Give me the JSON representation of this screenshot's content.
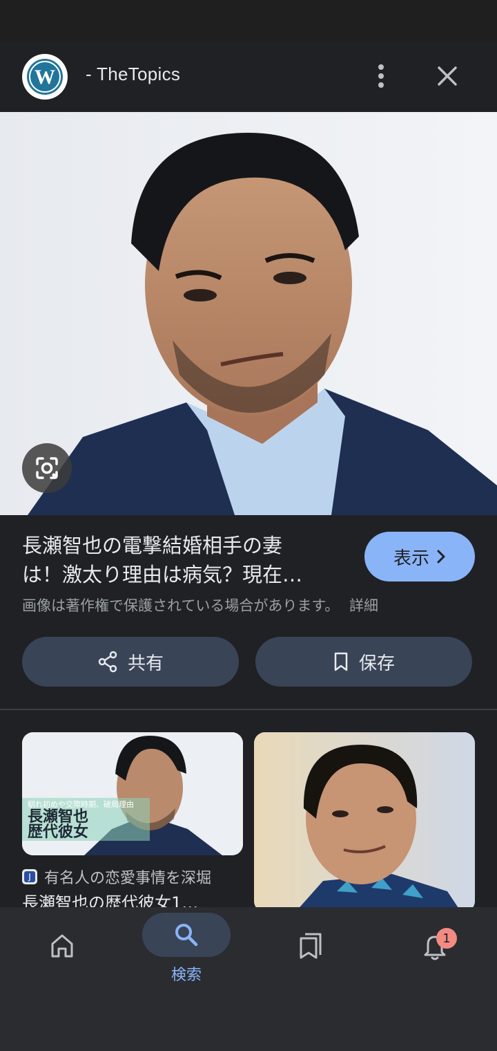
{
  "header": {
    "site_name": "- TheTopics",
    "logo_icon": "wordpress-icon",
    "menu_icon": "more-vert-icon",
    "close_icon": "close-icon"
  },
  "hero": {
    "lens_icon": "google-lens-icon"
  },
  "result": {
    "title_line1": "長瀬智也の電撃結婚相手の妻",
    "title_line2": "は！激太り理由は病気？現在…",
    "visit_label": "表示",
    "copyright_text": "画像は著作権で保護されている場合があります。",
    "detail_link": "詳細"
  },
  "actions": {
    "share_label": "共有",
    "save_label": "保存"
  },
  "related": [
    {
      "overlay_caption": "馴れ初めや交際時期、破局理由",
      "overlay_name_line1": "長瀬智也",
      "overlay_name_line2": "歴代彼女",
      "source": "有名人の恋愛事情を深堀",
      "title": "長瀬智也の歴代彼女1…"
    },
    {}
  ],
  "bottom_nav": {
    "home_icon": "home-icon",
    "search_label": "検索",
    "collections_icon": "bookmarks-icon",
    "notifications_badge": "1"
  },
  "colors": {
    "background": "#202124",
    "accent": "#8ab4f8",
    "chip": "#394457",
    "badge": "#f28b82"
  }
}
